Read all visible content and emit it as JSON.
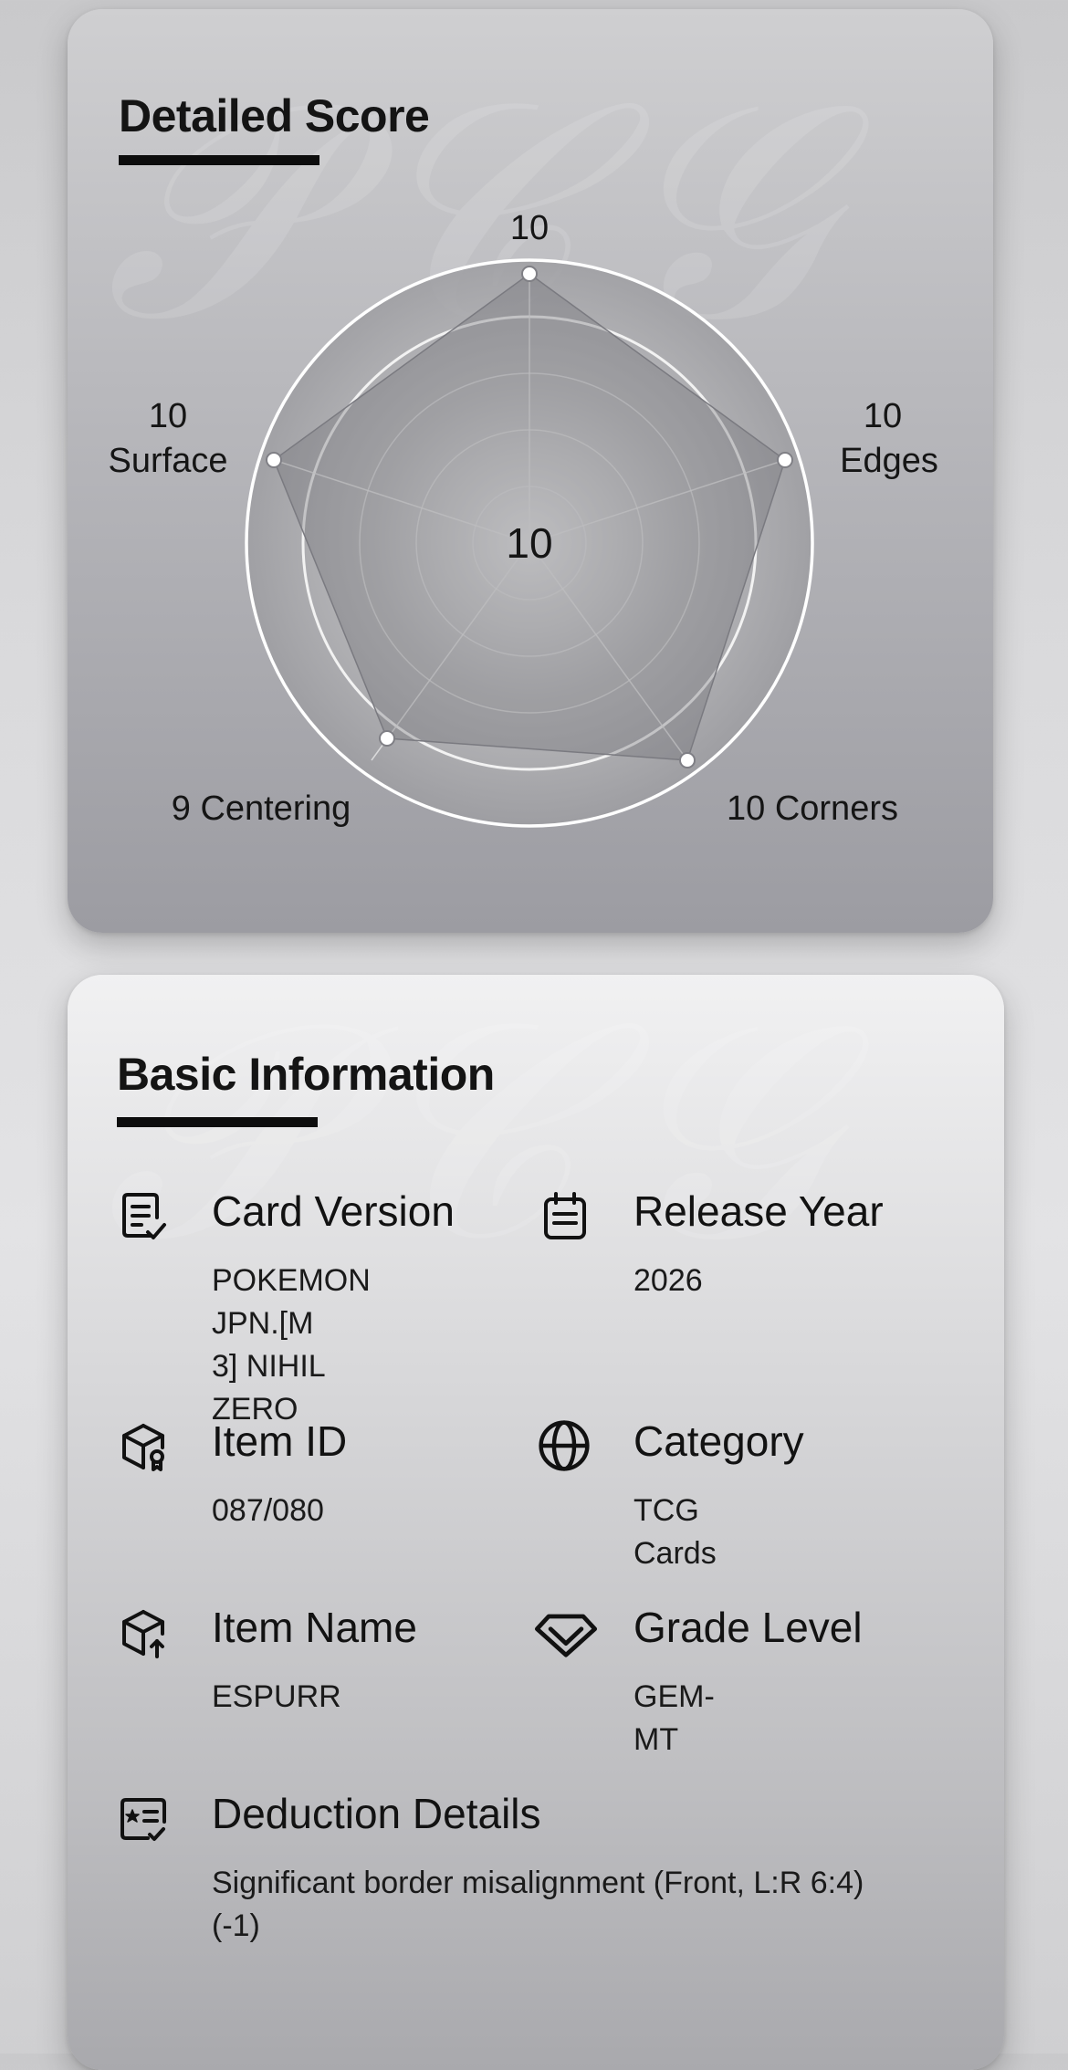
{
  "detailed_score": {
    "title": "Detailed Score",
    "center_value": "10",
    "chart_data": {
      "type": "radar",
      "axes": [
        "Centering",
        "Edges",
        "Corners",
        "Surface"
      ],
      "values": {
        "Centering": 9,
        "Edges": 10,
        "Corners": 10,
        "Surface": 10
      },
      "labels": {
        "top_value": "10",
        "surface_value": "10",
        "surface_label": "Surface",
        "edges_value": "10",
        "edges_label": "Edges",
        "centering": "9 Centering",
        "corners": "10 Corners"
      }
    }
  },
  "basic_info": {
    "title": "Basic Information",
    "items": [
      {
        "icon": "document-check-icon",
        "label": "Card Version",
        "value_lines": [
          "POKEMON JPN.[M",
          "3] NIHIL ZERO"
        ]
      },
      {
        "icon": "calendar-icon",
        "label": "Release Year",
        "value": "2026"
      },
      {
        "icon": "cube-badge-icon",
        "label": "Item ID",
        "value": "087/080"
      },
      {
        "icon": "globe-icon",
        "label": "Category",
        "value": "TCG Cards"
      },
      {
        "icon": "cube-arrow-icon",
        "label": "Item Name",
        "value": "ESPURR"
      },
      {
        "icon": "diamond-icon",
        "label": "Grade Level",
        "value": "GEM-MT"
      },
      {
        "icon": "star-list-icon",
        "label": "Deduction Details",
        "value_lines": [
          "Significant border misalignment (Front, L:R 6:4)",
          "(-1)"
        ]
      }
    ]
  }
}
